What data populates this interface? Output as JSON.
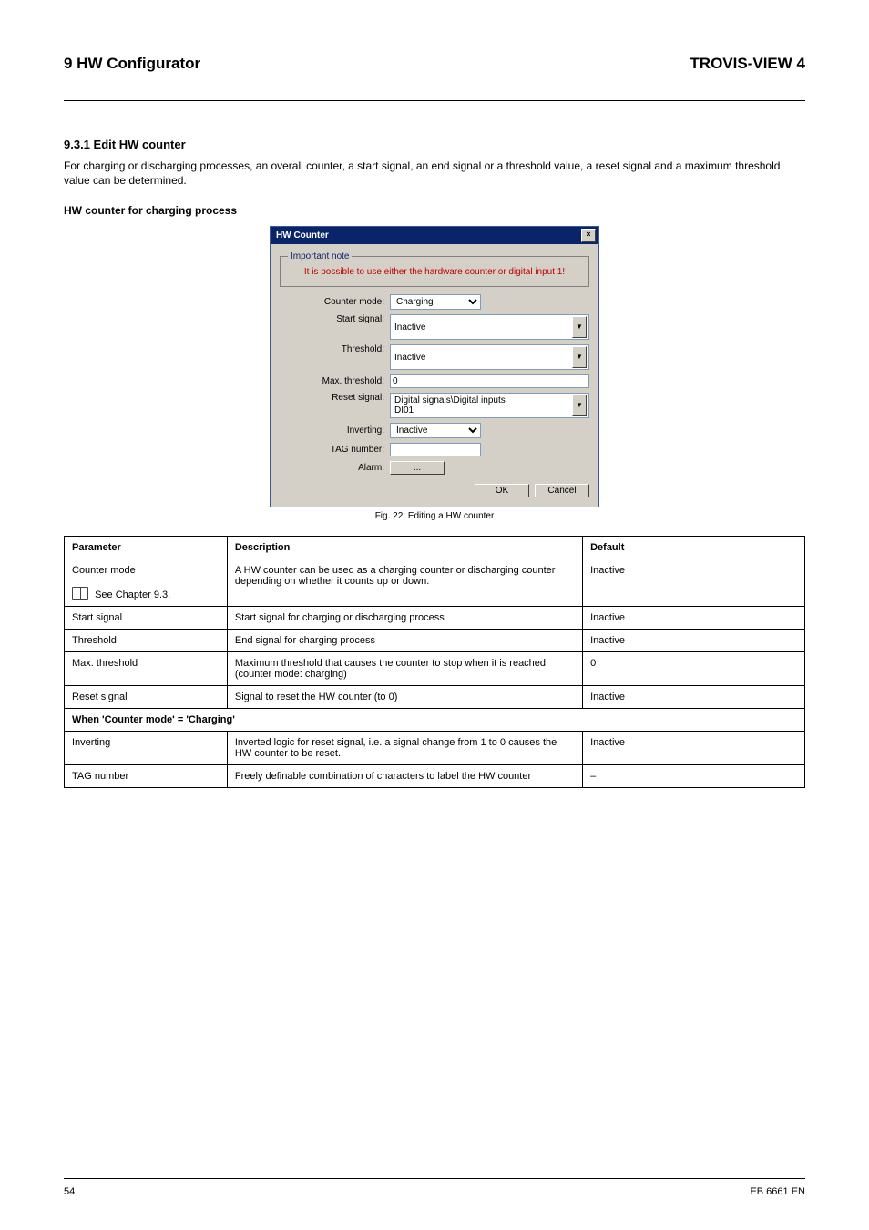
{
  "header": {
    "left": "9 HW Configurator",
    "right": "TROVIS-VIEW 4"
  },
  "section_title": "9.3.1  Edit HW counter",
  "intro": "For charging or discharging processes, an overall counter, a start signal, an end signal or a threshold value, a reset signal and a maximum threshold value can be determined.",
  "subtitle": "HW counter for charging process",
  "dialog": {
    "title": "HW Counter",
    "legend": "Important note",
    "note": "It is possible to use either the hardware counter or digital input 1!",
    "labels": {
      "counter_mode": "Counter mode:",
      "start_signal": "Start signal:",
      "threshold": "Threshold:",
      "max_threshold": "Max. threshold:",
      "reset_signal": "Reset signal:",
      "inverting": "Inverting:",
      "tag_number": "TAG number:",
      "alarm": "Alarm:"
    },
    "values": {
      "counter_mode": "Charging",
      "start_signal": "Inactive",
      "threshold": "Inactive",
      "max_threshold": "0",
      "reset_signal_line1": "Digital signals\\Digital inputs",
      "reset_signal_line2": "DI01",
      "inverting": "Inactive",
      "tag_number": "",
      "alarm_btn": "..."
    },
    "buttons": {
      "ok": "OK",
      "cancel": "Cancel"
    }
  },
  "caption": "Fig. 22:  Editing a HW counter",
  "table": {
    "headers": {
      "parameter": "Parameter",
      "description": "Description",
      "default": "Default"
    },
    "rows": [
      {
        "p": "Counter mode",
        "p_note": "See Chapter 9.3.",
        "d": "A HW counter can be used as a charging counter or discharging counter depending on whether it counts up or down.",
        "v": "Inactive"
      },
      {
        "p": "Start signal",
        "d": "Start signal for charging or discharging process",
        "v": "Inactive"
      },
      {
        "p": "Threshold",
        "d": "End signal for charging process",
        "v": "Inactive"
      },
      {
        "p": "Max. threshold",
        "d": "Maximum threshold that causes the counter to stop when it is reached (counter mode: charging)",
        "v": "0"
      },
      {
        "p": "Reset signal",
        "d": "Signal to reset the HW counter (to 0)",
        "v": "Inactive"
      },
      {
        "p": "Inverting",
        "d": "Inverted logic for reset signal, i.e. a signal change from 1 to 0 causes the HW counter to be reset.",
        "v": "Inactive"
      },
      {
        "p": "TAG number",
        "d": "Freely definable combination of characters to label the HW counter",
        "v": "–"
      }
    ],
    "subhead": "When 'Counter mode' = 'Charging'"
  },
  "footer": {
    "left": "54",
    "right": "EB 6661 EN"
  }
}
